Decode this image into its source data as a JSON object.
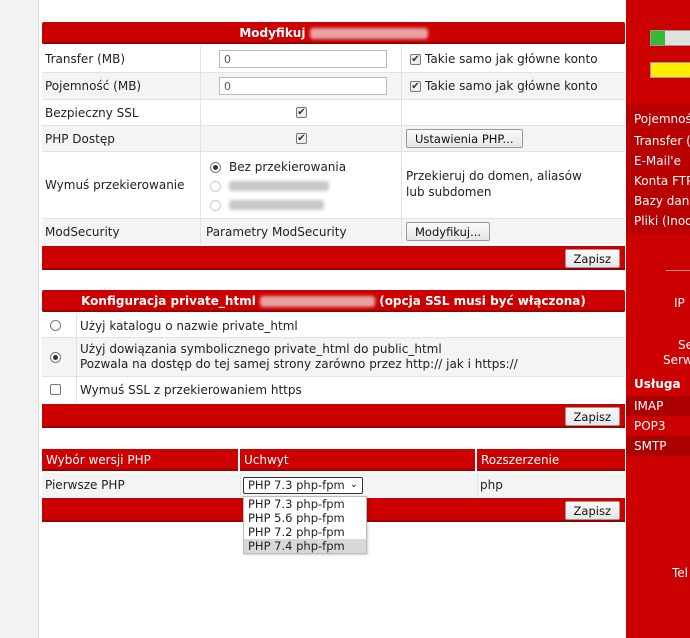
{
  "modify_section": {
    "title_prefix": "Modyfikuj",
    "rows": [
      {
        "label": "Transfer (MB)",
        "value": "0",
        "same_label": "Takie samo jak główne konto"
      },
      {
        "label": "Pojemność (MB)",
        "value": "0",
        "same_label": "Takie samo jak główne konto"
      }
    ],
    "ssl_label": "Bezpieczny SSL",
    "php_label": "PHP Dostęp",
    "php_settings_btn": "Ustawienia PHP...",
    "redirect_label": "Wymuś przekierowanie",
    "redirect_option_none": "Bez przekierowania",
    "redirect_hint": "Przekieruj do domen, aliasów lub subdomen",
    "modsec_label": "ModSecurity",
    "modsec_params": "Parametry ModSecurity",
    "modsec_btn": "Modyfikuj...",
    "save_btn": "Zapisz"
  },
  "private_html": {
    "title_prefix": "Konfiguracja private_html",
    "title_suffix": "(opcja SSL musi być włączona)",
    "option1": "Użyj katalogu o nazwie private_html",
    "option2_line1": "Użyj dowiązania symbolicznego private_html do public_html",
    "option2_line2": "Pozwala na dostęp do tej samej strony zarówno przez http:// jak i https://",
    "force_ssl": "Wymuś SSL z przekierowaniem https",
    "save_btn": "Zapisz"
  },
  "php_version": {
    "headers": [
      "Wybór wersji PHP",
      "Uchwyt",
      "Rozszerzenie"
    ],
    "row_label": "Pierwsze PHP",
    "selected": "PHP 7.3 php-fpm",
    "extension": "php",
    "options": [
      "PHP 7.3 php-fpm",
      "PHP 5.6 php-fpm",
      "PHP 7.2 php-fpm",
      "PHP 7.4 php-fpm"
    ],
    "save_btn": "Zapisz"
  },
  "sidebar": {
    "items": [
      "Pojemność",
      "Transfer (",
      "E-Mail'e",
      "Konta FTP",
      "Bazy dany",
      "Pliki (Inod"
    ],
    "ip_label": "IP",
    "se_label": "Se",
    "serw_label": "Serw",
    "service_label": "Usługa",
    "services": [
      "IMAP",
      "POP3",
      "SMTP"
    ],
    "tel_label": "Tel"
  }
}
